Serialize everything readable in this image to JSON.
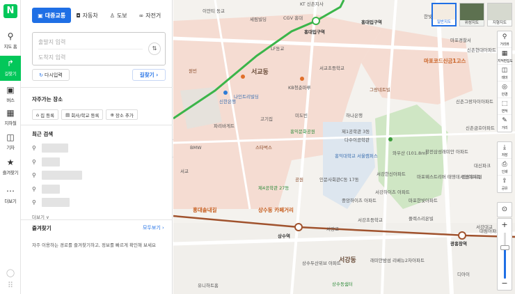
{
  "rail": {
    "logo": "N",
    "items": [
      {
        "label": "지도 홈",
        "icon": "map-pin-icon"
      },
      {
        "label": "길찾기",
        "icon": "route-icon"
      },
      {
        "label": "버스",
        "icon": "bus-icon"
      },
      {
        "label": "지하철",
        "icon": "subway-icon"
      },
      {
        "label": "기차",
        "icon": "train-icon"
      },
      {
        "label": "즐겨찾기",
        "icon": "star-icon"
      },
      {
        "label": "더보기",
        "icon": "more-icon"
      }
    ]
  },
  "panel": {
    "modes": [
      {
        "label": "대중교통",
        "icon": "transit-icon"
      },
      {
        "label": "자동차",
        "icon": "car-icon"
      },
      {
        "label": "도보",
        "icon": "walk-icon"
      },
      {
        "label": "자전거",
        "icon": "bike-icon"
      }
    ],
    "origin_placeholder": "출발지 입력",
    "destination_placeholder": "도착지 입력",
    "reenter_label": "다시입력",
    "route_label": "길찾기 ›",
    "frequent_title": "자주가는 장소",
    "places": [
      {
        "label": "집 등록",
        "icon": "home-icon"
      },
      {
        "label": "회사/학교 등록",
        "icon": "office-icon"
      },
      {
        "label": "장소 추가",
        "icon": "plus-icon"
      }
    ],
    "recent_title": "최근 검색",
    "more_label": "더보기 ∨",
    "favorites_title": "즐겨찾기",
    "favorites_all": "모두보기 ›",
    "favorites_desc": "자주 이용하는 경로를 즐겨찾기하고, 정보를 빠르게 확인해 보세요"
  },
  "map": {
    "layers": [
      "일반지도",
      "위성지도",
      "지형지도"
    ],
    "tools": [
      "거리뷰",
      "지적편집도",
      "테마",
      "반경",
      "면적",
      "거리"
    ],
    "tools2": [
      "저장",
      "인쇄",
      "공유"
    ],
    "labels": {
      "l1": "KT 신촌지사",
      "l2": "이안티 동교",
      "l3": "세림빌딩",
      "l4": "CGV 홍대",
      "l5": "LF동교",
      "l6": "홍대입구역",
      "l7": "홍대입구역",
      "l8": "한빛빌딩",
      "l9": "원빈",
      "l10": "서교동",
      "l11": "서교초등학교",
      "l12": "KB청춘마루",
      "l13": "그랑네트빌",
      "l14": "마포경찰서",
      "l15": "마포코드신금1고스",
      "l16": "신촌그랑자이아파트",
      "l17": "신촌현대아파트",
      "l18": "나인트리빌딩",
      "l19": "신한은행",
      "l20": "고기집",
      "l21": "홍익문화공원",
      "l22": "제1공학관 3동",
      "l23": "홍익대학교 서울캠퍼스",
      "l24": "와우산 (101.8m)",
      "l25": "마포웨스트리버 태영데시앙아파트",
      "l26": "대신파크",
      "l27": "하나은행",
      "l28": "BMW",
      "l29": "홍대솔내길",
      "l30": "상수동 카페거리",
      "l31": "상수역",
      "l32": "광흥창역",
      "l33": "서강동",
      "l34": "서강대교",
      "l35": "서강초등학교",
      "l36": "서강하이츠 아파트",
      "l37": "플렉스리온빌",
      "l38": "파리바게트",
      "l39": "미도빈",
      "l40": "스타벅스",
      "l41": "공원",
      "l42": "제4공학관 27동",
      "l43": "인문사회관C동 17동",
      "l44": "중앙하이츠 아파트",
      "l45": "서강한신아파트",
      "l46": "마포한빛아파트",
      "l47": "서강로",
      "l48": "래미안밤섬 리베뉴2차아파트",
      "l49": "상수두산위브 아파트",
      "l50": "디아이",
      "l51": "유니하트홈",
      "l52": "상수동쉼터",
      "l53": "창전삼성래미안 아파트",
      "l54": "신촌금호아파트",
      "l55": "정성유치원",
      "l56": "서교",
      "l57": "다수이공학관",
      "l58": "대림아파트"
    }
  }
}
